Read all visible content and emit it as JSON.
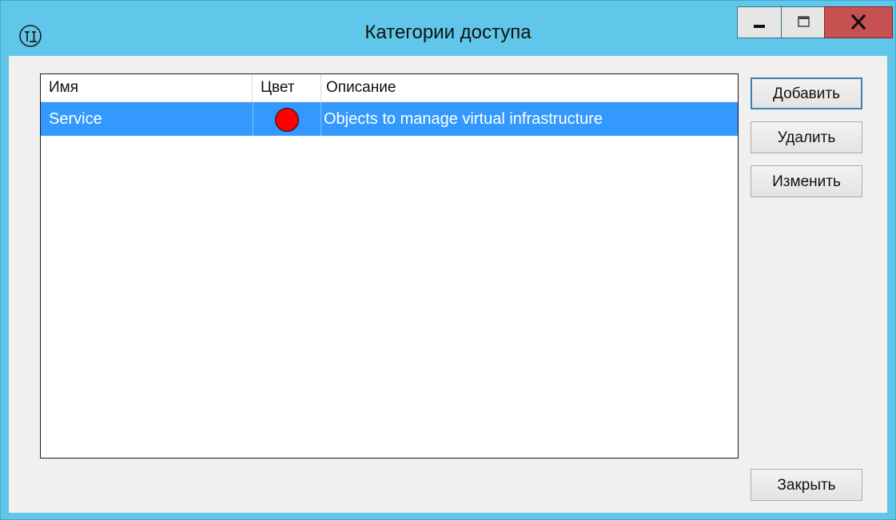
{
  "window": {
    "title": "Категории доступа",
    "icon": "app-logo-icon",
    "controls": {
      "minimize_icon": "minimize-icon",
      "maximize_icon": "maximize-icon",
      "close_icon": "close-icon"
    }
  },
  "list": {
    "columns": [
      "Имя",
      "Цвет",
      "Описание"
    ],
    "rows": [
      {
        "name": "Service",
        "color": "#ff0000",
        "description": "Objects to manage virtual infrastructure",
        "selected": true
      }
    ]
  },
  "buttons": {
    "add": "Добавить",
    "delete": "Удалить",
    "edit": "Изменить",
    "close": "Закрыть"
  },
  "colors": {
    "titlebar": "#60c7ea",
    "selection": "#3399ff",
    "close_button": "#c75050"
  }
}
